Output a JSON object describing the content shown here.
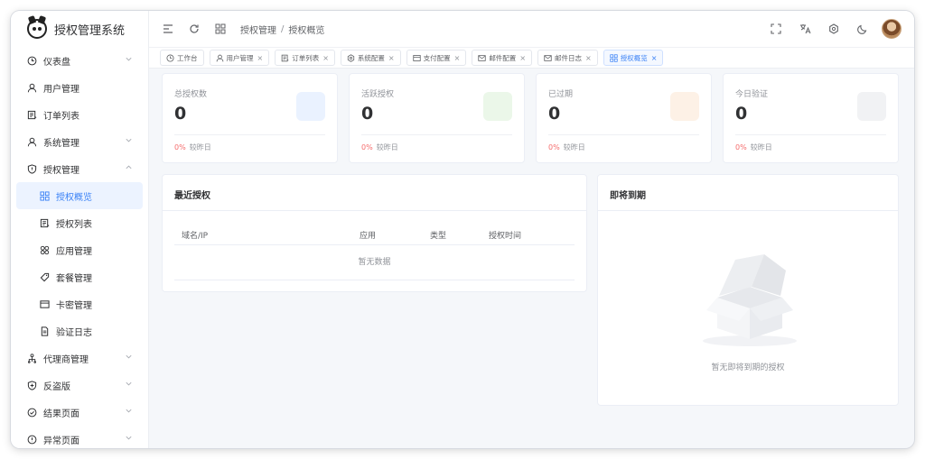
{
  "app": {
    "title": "授权管理系统"
  },
  "sidebar": {
    "items": [
      {
        "label": "仪表盘",
        "icon": "clock-icon",
        "expandable": true
      },
      {
        "label": "用户管理",
        "icon": "user-icon",
        "expandable": false
      },
      {
        "label": "订单列表",
        "icon": "list-icon",
        "expandable": false
      },
      {
        "label": "系统管理",
        "icon": "user-icon",
        "expandable": true
      },
      {
        "label": "授权管理",
        "icon": "shield-icon",
        "expandable": true,
        "expanded": true
      },
      {
        "label": "授权概览",
        "icon": "grid-icon",
        "sub": true,
        "active": true
      },
      {
        "label": "授权列表",
        "icon": "list-icon",
        "sub": true
      },
      {
        "label": "应用管理",
        "icon": "apps-icon",
        "sub": true
      },
      {
        "label": "套餐管理",
        "icon": "tag-icon",
        "sub": true
      },
      {
        "label": "卡密管理",
        "icon": "card-icon",
        "sub": true
      },
      {
        "label": "验证日志",
        "icon": "doc-icon",
        "sub": true
      },
      {
        "label": "代理商管理",
        "icon": "org-icon",
        "expandable": true
      },
      {
        "label": "反盗版",
        "icon": "shield-plus-icon",
        "expandable": true
      },
      {
        "label": "结果页面",
        "icon": "check-circle-icon",
        "expandable": true
      },
      {
        "label": "异常页面",
        "icon": "info-circle-icon",
        "expandable": true
      }
    ]
  },
  "header": {
    "breadcrumb": [
      "授权管理",
      "授权概览"
    ],
    "breadcrumb_sep": "/"
  },
  "tabs": [
    {
      "label": "工作台",
      "icon": "clock-icon",
      "closable": false
    },
    {
      "label": "用户管理",
      "icon": "user-icon",
      "closable": true
    },
    {
      "label": "订单列表",
      "icon": "list-icon",
      "closable": true
    },
    {
      "label": "系统配置",
      "icon": "gear-icon",
      "closable": true
    },
    {
      "label": "支付配置",
      "icon": "card-icon",
      "closable": true
    },
    {
      "label": "邮件配置",
      "icon": "mail-icon",
      "closable": true
    },
    {
      "label": "邮件日志",
      "icon": "mail-icon",
      "closable": true
    },
    {
      "label": "授权概览",
      "icon": "grid-icon",
      "closable": true,
      "active": true
    }
  ],
  "tab_close": "×",
  "stats": [
    {
      "label": "总授权数",
      "value": "0",
      "pct": "0%",
      "compare": "较昨日",
      "color": "#eaf2ff"
    },
    {
      "label": "活跃授权",
      "value": "0",
      "pct": "0%",
      "compare": "较昨日",
      "color": "#ebf7e9"
    },
    {
      "label": "已过期",
      "value": "0",
      "pct": "0%",
      "compare": "较昨日",
      "color": "#fdf1e6"
    },
    {
      "label": "今日验证",
      "value": "0",
      "pct": "0%",
      "compare": "较昨日",
      "color": "#f1f2f4"
    }
  ],
  "recent": {
    "title": "最近授权",
    "columns": [
      "域名/IP",
      "应用",
      "类型",
      "授权时间"
    ],
    "empty": "暂无数据"
  },
  "expiring": {
    "title": "即将到期",
    "empty": "暂无即将到期的授权"
  },
  "colors": {
    "accent": "#3b82f6",
    "danger": "#f56c6c",
    "muted": "#909399"
  }
}
